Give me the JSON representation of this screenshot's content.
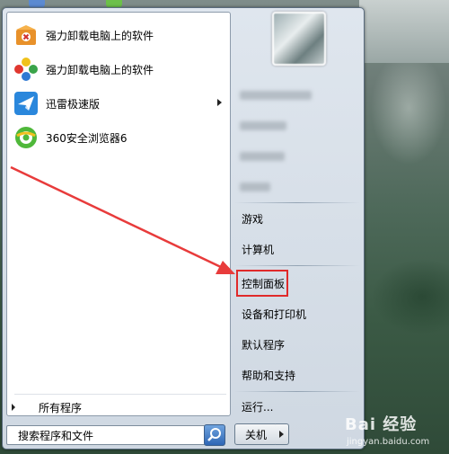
{
  "left_pane": {
    "apps": [
      {
        "label": "强力卸载电脑上的软件",
        "icon": "box-uninstall-icon",
        "has_submenu": false
      },
      {
        "label": "强力卸载电脑上的软件",
        "icon": "colorful-dots-icon",
        "has_submenu": false
      },
      {
        "label": "迅雷极速版",
        "icon": "thunder-bird-icon",
        "has_submenu": true
      },
      {
        "label": "360安全浏览器6",
        "icon": "360-browser-icon",
        "has_submenu": false
      }
    ],
    "all_programs": "所有程序",
    "search_placeholder": "搜索程序和文件"
  },
  "right_pane": {
    "items": [
      {
        "label": "游戏"
      },
      {
        "label": "计算机"
      },
      {
        "label": "控制面板"
      },
      {
        "label": "设备和打印机"
      },
      {
        "label": "默认程序"
      },
      {
        "label": "帮助和支持"
      },
      {
        "label": "运行..."
      }
    ],
    "shutdown_label": "关机"
  },
  "watermark": {
    "main": "Bai 经验",
    "sub": "jingyan.baidu.com"
  },
  "colors": {
    "annotation": "#e83b3b",
    "menu_border": "#5a6c7e"
  }
}
